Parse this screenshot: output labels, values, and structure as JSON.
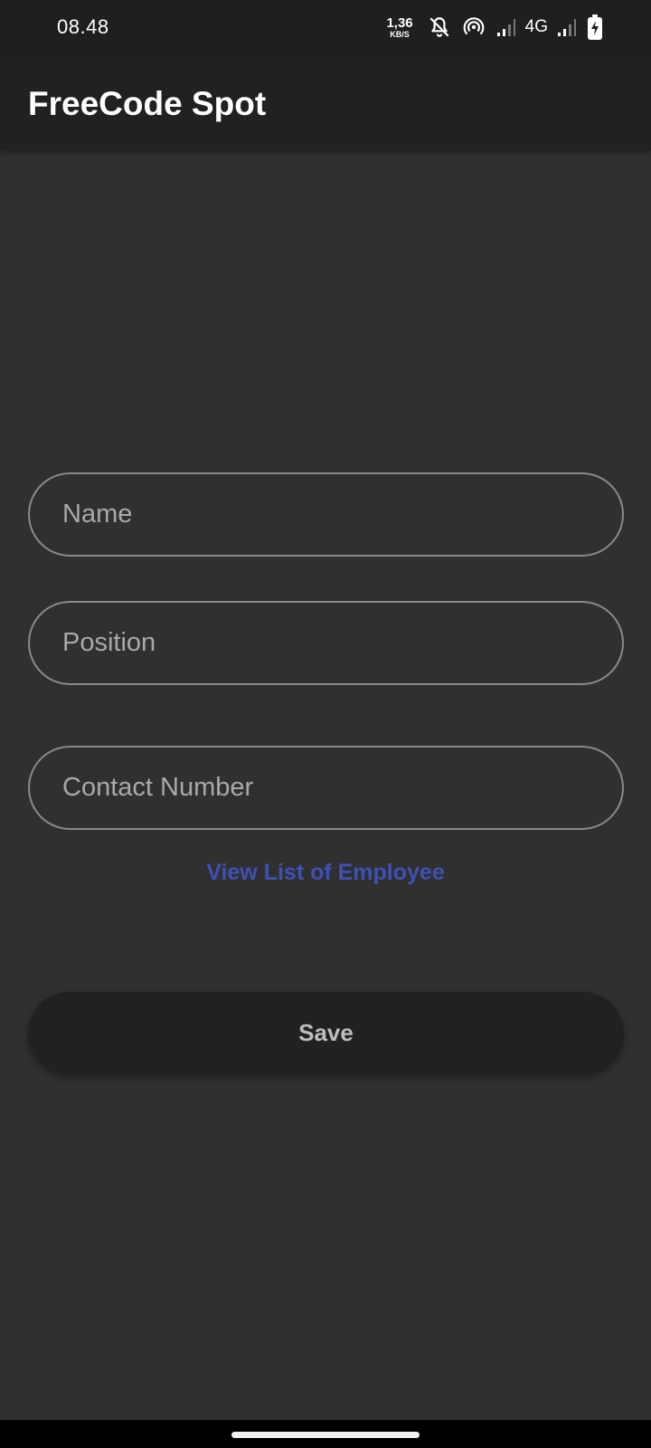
{
  "status_bar": {
    "time": "08.48",
    "net_speed_value": "1,36",
    "net_speed_unit": "KB/S",
    "network_type": "4G",
    "icons": [
      "notifications-off-icon",
      "hotspot-icon",
      "signal-icon",
      "signal-icon",
      "battery-charging-icon"
    ]
  },
  "app_bar": {
    "title": "FreeCode Spot"
  },
  "form": {
    "name_placeholder": "Name",
    "position_placeholder": "Position",
    "contact_placeholder": "Contact Number",
    "view_list_link": "View List of Employee",
    "save_label": "Save"
  },
  "colors": {
    "background": "#303030",
    "app_bar": "#212121",
    "link": "#3f51b5",
    "field_border": "#8a8a8a"
  }
}
